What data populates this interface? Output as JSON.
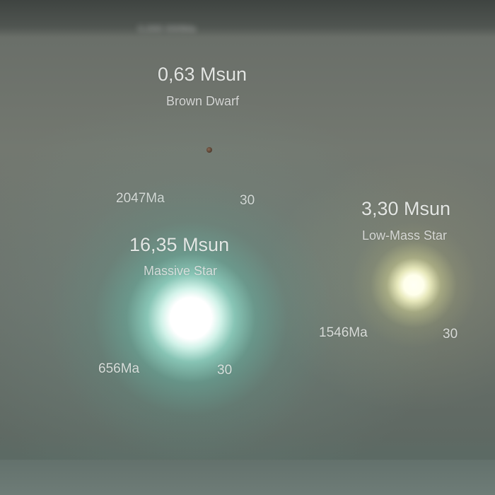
{
  "top_caption": "0,000 000Ma",
  "bodies": {
    "brown_dwarf": {
      "mass": "0,63 Msun",
      "type": "Brown Dwarf",
      "age": "2047Ma",
      "count": "30",
      "color": "#5a4334"
    },
    "massive_star": {
      "mass": "16,35 Msun",
      "type": "Massive Star",
      "age": "656Ma",
      "count": "30",
      "color": "#bdf5e6"
    },
    "low_mass_star": {
      "mass": "3,30 Msun",
      "type": "Low-Mass Star",
      "age": "1546Ma",
      "count": "30",
      "color": "#fafad2"
    }
  }
}
